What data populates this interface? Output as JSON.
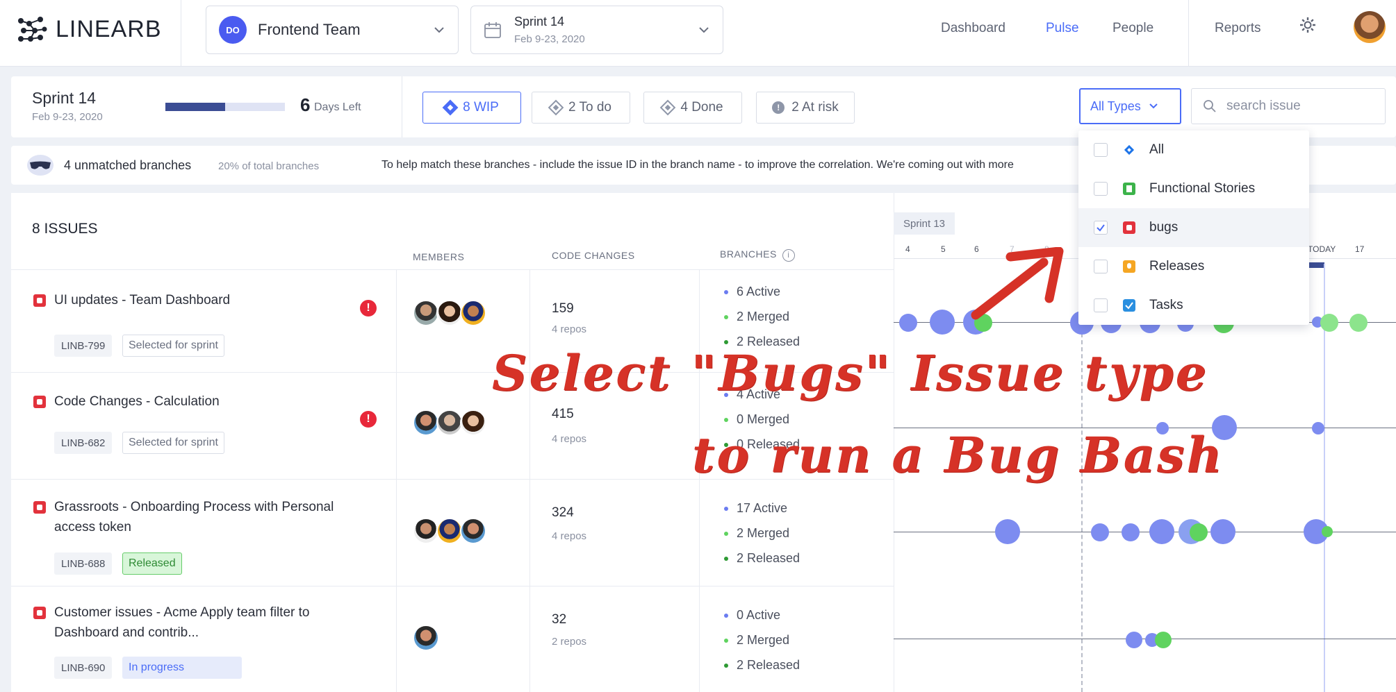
{
  "brand": {
    "logo_text_a": "LINEAR",
    "logo_text_b": "B"
  },
  "team": {
    "initials": "DO",
    "name": "Frontend Team"
  },
  "sprint_select": {
    "name": "Sprint 14",
    "dates": "Feb 9-23, 2020"
  },
  "nav": {
    "dashboard": "Dashboard",
    "pulse": "Pulse",
    "people": "People",
    "reports": "Reports"
  },
  "sprint_bar": {
    "title": "Sprint 14",
    "dates": "Feb 9-23, 2020",
    "progress": 0.5,
    "days_left_num": "6",
    "days_left_label": "Days Left",
    "chips": {
      "wip": "8 WIP",
      "todo": "2 To do",
      "done": "4 Done",
      "at_risk": "2 At risk"
    },
    "types_label": "All Types",
    "search_placeholder": "search issue"
  },
  "unmatched": {
    "title": "4 unmatched branches",
    "sub": "20% of total branches",
    "help": "To help match these branches - include the issue ID in the branch name - to improve the correlation.  We're coming out with more"
  },
  "table": {
    "issues_count": "8 ISSUES",
    "columns": {
      "members": "MEMBERS",
      "code_changes": "CODE CHANGES",
      "branches": "BRANCHES"
    },
    "rows": [
      {
        "title": "UI updates - Team Dashboard",
        "key": "LINB-799",
        "status": "Selected for sprint",
        "code": "159",
        "repos": "4 repos",
        "active": "6 Active",
        "merged": "2 Merged",
        "released": "2 Released"
      },
      {
        "title": "Code Changes - Calculation",
        "key": "LINB-682",
        "status": "Selected for sprint",
        "code": "415",
        "repos": "4 repos",
        "active": "4 Active",
        "merged": "0 Merged",
        "released": "0 Released"
      },
      {
        "title_1": "Grassroots - Onboarding Process with Personal",
        "title_2": "access token",
        "key": "LINB-688",
        "status": "Released",
        "code": "324",
        "repos": "4 repos",
        "active": "17 Active",
        "merged": "2 Merged",
        "released": "2 Released"
      },
      {
        "title_1": "Customer issues - Acme Apply team filter to",
        "title_2": "Dashboard and contrib...",
        "key": "LINB-690",
        "status": "In progress",
        "code": "32",
        "repos": "2 repos",
        "active": "0 Active",
        "merged": "2 Merged",
        "released": "2 Released"
      }
    ]
  },
  "timeline": {
    "sprint_label": "Sprint 13",
    "days": [
      "4",
      "5",
      "6",
      "7",
      "8"
    ],
    "today_label": "TODAY",
    "after_today": "17"
  },
  "dropdown": {
    "items": [
      {
        "label": "All",
        "checked": false
      },
      {
        "label": "Functional Stories",
        "checked": false
      },
      {
        "label": "bugs",
        "checked": true
      },
      {
        "label": "Releases",
        "checked": false
      },
      {
        "label": "Tasks",
        "checked": false
      }
    ]
  },
  "annotation": {
    "line1": "Select \"Bugs\" Issue type",
    "line2": "to run a Bug Bash"
  },
  "colors": {
    "accent": "#4a6cf7",
    "bug": "#e2323c",
    "merged": "#5fd35f",
    "active": "#6b7cf0",
    "annotation": "#d63227"
  }
}
